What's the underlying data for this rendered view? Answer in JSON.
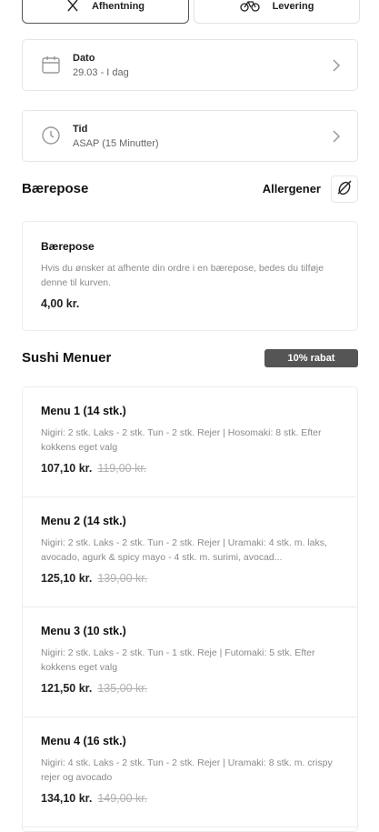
{
  "order_type": {
    "pickup_label": "Afhentning",
    "delivery_label": "Levering"
  },
  "date": {
    "label": "Dato",
    "value": "29.03 - I dag"
  },
  "time": {
    "label": "Tid",
    "value": "ASAP (15 Minutter)"
  },
  "bag_section": {
    "title": "Bærepose",
    "allergens_label": "Allergener",
    "item": {
      "name": "Bærepose",
      "description": "Hvis du ønsker at afhente din ordre i en bærepose, bedes du tilføje denne til kurven.",
      "price": "4,00 kr."
    }
  },
  "menus_section": {
    "title": "Sushi Menuer",
    "badge": "10% rabat",
    "items": [
      {
        "name": "Menu 1 (14 stk.)",
        "description": "Nigiri: 2 stk. Laks - 2 stk. Tun - 2 stk. Rejer | Hosomaki: 8 stk. Efter kokkens eget valg",
        "price": "107,10 kr.",
        "old_price": "119,00 kr."
      },
      {
        "name": "Menu 2 (14 stk.)",
        "description": "Nigiri: 2 stk. Laks - 2 stk. Tun - 2 stk. Rejer | Uramaki: 4 stk. m. laks, avocado, agurk & spicy mayo - 4 stk. m. surimi, avocad...",
        "price": "125,10 kr.",
        "old_price": "139,00 kr."
      },
      {
        "name": "Menu 3 (10 stk.)",
        "description": "Nigiri: 2 stk. Laks - 2 stk. Tun - 1 stk. Reje | Futomaki: 5 stk. Efter kokkens eget valg",
        "price": "121,50 kr.",
        "old_price": "135,00 kr."
      },
      {
        "name": "Menu 4 (16 stk.)",
        "description": "Nigiri: 4 stk. Laks - 2 stk. Tun - 2 stk. Rejer | Uramaki: 8 stk. m. crispy rejer og avocado",
        "price": "134,10 kr.",
        "old_price": "149,00 kr."
      }
    ]
  }
}
